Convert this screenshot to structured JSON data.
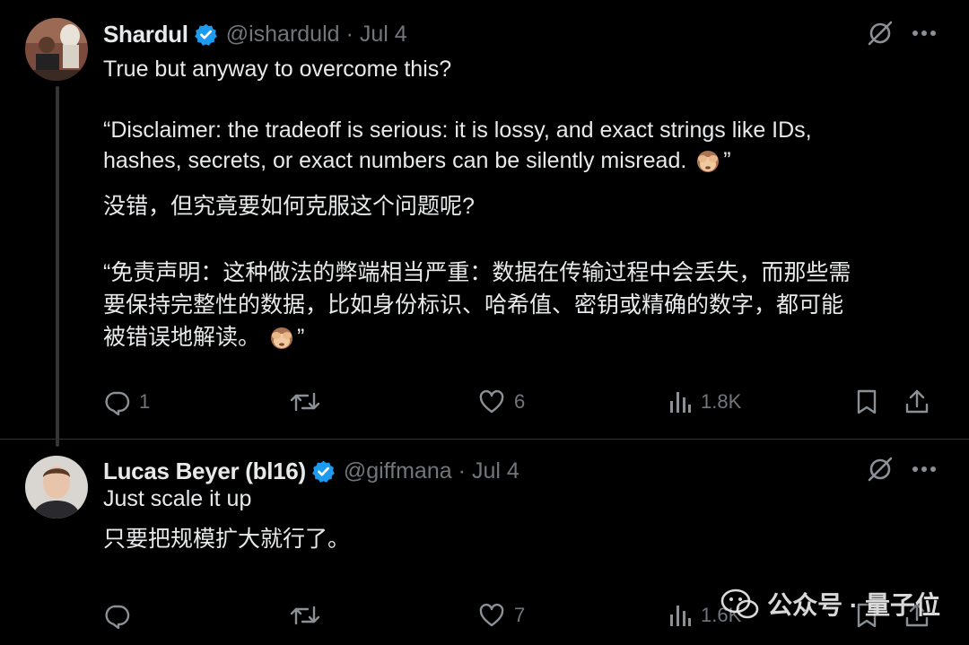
{
  "tweets": [
    {
      "name": "Shardul",
      "handle": "@isharduld",
      "separator": "·",
      "date": "Jul 4",
      "lines": {
        "l1": "True but anyway to overcome this?",
        "l2": "“Disclaimer: the tradeoff is serious: it is lossy, and exact strings like IDs,",
        "l3": "hashes, secrets, or exact numbers can be silently misread.",
        "l3_end": "”",
        "zh1": "没错，但究竟要如何克服这个问题呢?",
        "zh2": "“免责声明：这种做法的弊端相当严重：数据在传输过程中会丢失，而那些需",
        "zh3": "要保持完整性的数据，比如身份标识、哈希值、密钥或精确的数字，都可能",
        "zh4": "被错误地解读。",
        "zh4_end": "”"
      },
      "stats": {
        "replies": "1",
        "reposts": "",
        "likes": "6",
        "views": "1.8K"
      }
    },
    {
      "name": "Lucas Beyer (bl16)",
      "handle": "@giffmana",
      "separator": "·",
      "date": "Jul 4",
      "lines": {
        "l1": "Just scale it up",
        "zh1": "只要把规模扩大就行了。"
      },
      "stats": {
        "replies": "",
        "reposts": "",
        "likes": "7",
        "views": "1.6K"
      }
    }
  ],
  "icons": {
    "verified": "verified-badge-icon",
    "grok": "grok-icon",
    "more": "more-icon",
    "reply": "reply-icon",
    "repost": "repost-icon",
    "like": "like-icon",
    "views": "views-icon",
    "bookmark": "bookmark-icon",
    "share": "share-icon",
    "emoji": "see-no-evil-monkey-emoji"
  },
  "colors": {
    "background": "#000000",
    "text": "#e7e9ea",
    "muted": "#71767b",
    "verified": "#1d9bf0"
  },
  "watermark": {
    "text": "公众号 · 量子位",
    "icon": "wechat-icon"
  }
}
